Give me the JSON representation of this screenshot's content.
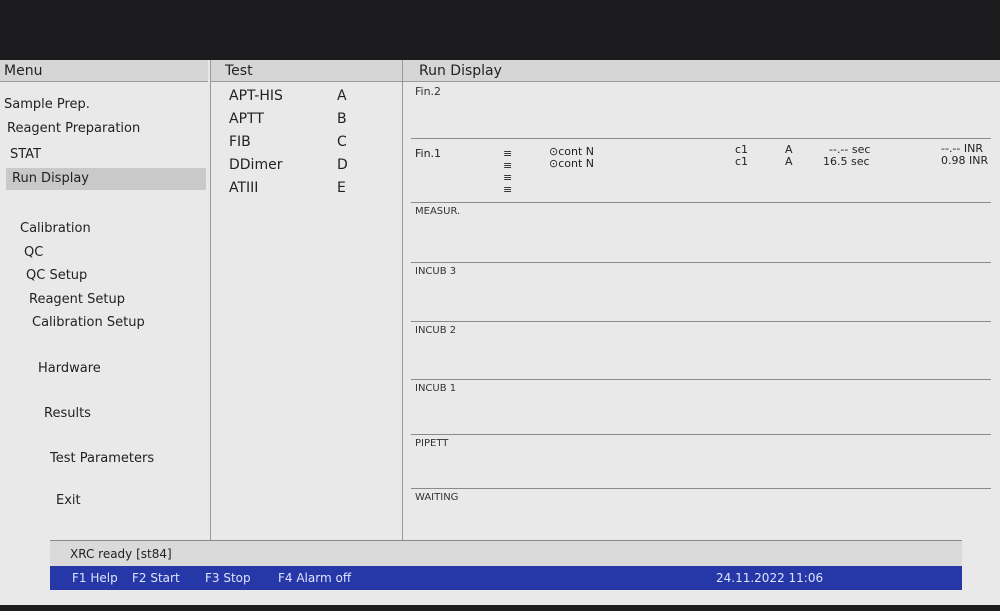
{
  "menu": {
    "header": "Menu",
    "items": [
      {
        "label": "Sample Prep.",
        "selected": false
      },
      {
        "label": "Reagent Preparation",
        "selected": false
      },
      {
        "label": "STAT",
        "selected": false
      },
      {
        "label": "Run Display",
        "selected": true
      },
      {
        "label": "Calibration",
        "selected": false
      },
      {
        "label": "QC",
        "selected": false
      },
      {
        "label": "QC Setup",
        "selected": false
      },
      {
        "label": "Reagent Setup",
        "selected": false
      },
      {
        "label": "Calibration Setup",
        "selected": false
      },
      {
        "label": "Hardware",
        "selected": false
      },
      {
        "label": "Results",
        "selected": false
      },
      {
        "label": "Test Parameters",
        "selected": false
      },
      {
        "label": "Exit",
        "selected": false
      }
    ]
  },
  "test": {
    "header": "Test",
    "items": [
      {
        "name": "APT-HIS",
        "code": "A"
      },
      {
        "name": "APTT",
        "code": "B"
      },
      {
        "name": "FIB",
        "code": "C"
      },
      {
        "name": "DDimer",
        "code": "D"
      },
      {
        "name": "ATIII",
        "code": "E"
      }
    ]
  },
  "run_display": {
    "header": "Run Display",
    "fin2_label": "Fin.2",
    "fin1": {
      "label": "Fin.1",
      "rows": [
        {
          "marker": "≡",
          "control": "⊙cont N",
          "cuvette": "c1",
          "test": "A",
          "time": "--.-- sec",
          "result": "--.-- INR"
        },
        {
          "marker": "≡",
          "control": "⊙cont N",
          "cuvette": "c1",
          "test": "A",
          "time": "16.5 sec",
          "result": "0.98 INR"
        }
      ],
      "extra_markers": [
        "≡",
        "≡"
      ]
    },
    "panels": [
      "MEASUR.",
      "INCUB 3",
      "INCUB 2",
      "INCUB 1",
      "PIPETT",
      "WAITING"
    ]
  },
  "status": {
    "message": "XRC ready  [st84]"
  },
  "function_keys": {
    "f1": "F1 Help",
    "f2": "F2 Start",
    "f3": "F3 Stop",
    "f4": "F4 Alarm off",
    "datetime": "24.11.2022  11:06"
  }
}
